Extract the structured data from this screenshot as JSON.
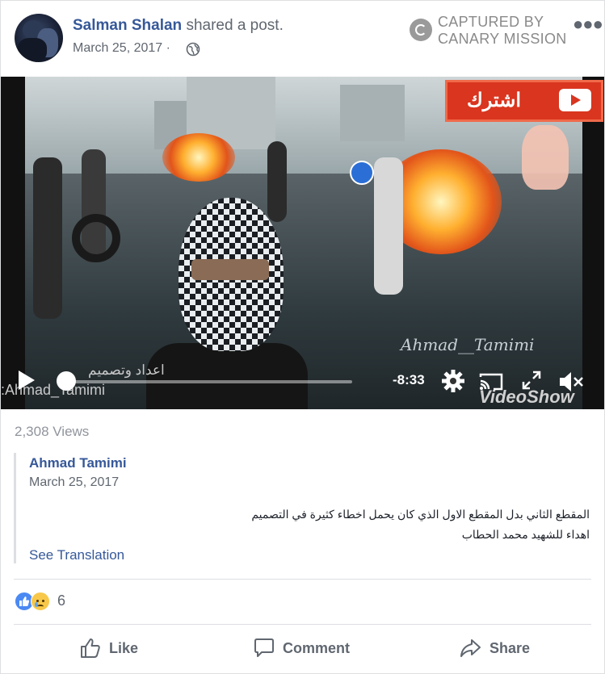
{
  "post": {
    "author": "Salman Shalan",
    "action": " shared a post.",
    "date": "March 25, 2017 ·",
    "privacy_icon": "globe-icon",
    "more_icon": "more-options-icon"
  },
  "watermark": {
    "line1": "CAPTURED BY",
    "line2": "CANARY MISSION"
  },
  "video": {
    "subscribe_label": "اشترك",
    "overlay_handle": "Ahmad__Tamimi",
    "overlay_bottom_left": ":Ahmad_Tamimi",
    "overlay_arabic": "اعداد وتصميم",
    "overlay_app": "VideoShow",
    "time_remaining": "-8:33",
    "progress": 0.0
  },
  "stats": {
    "views": "2,308 Views"
  },
  "original": {
    "author": "Ahmad Tamimi",
    "date": "March 25, 2017",
    "text_line1": "المقطع الثاني بدل المقطع الاول الذي كان يحمل اخطاء كثيرة في التصميم",
    "text_line2": "اهداء للشهيد محمد الحطاب",
    "see_translation": "See Translation"
  },
  "reactions": {
    "count": "6",
    "types": [
      "like",
      "sad"
    ]
  },
  "actions": {
    "like": "Like",
    "comment": "Comment",
    "share": "Share"
  },
  "colors": {
    "link": "#365899",
    "secondary": "#606770",
    "divider": "#dddfe2",
    "like_blue": "#4a89f3"
  }
}
